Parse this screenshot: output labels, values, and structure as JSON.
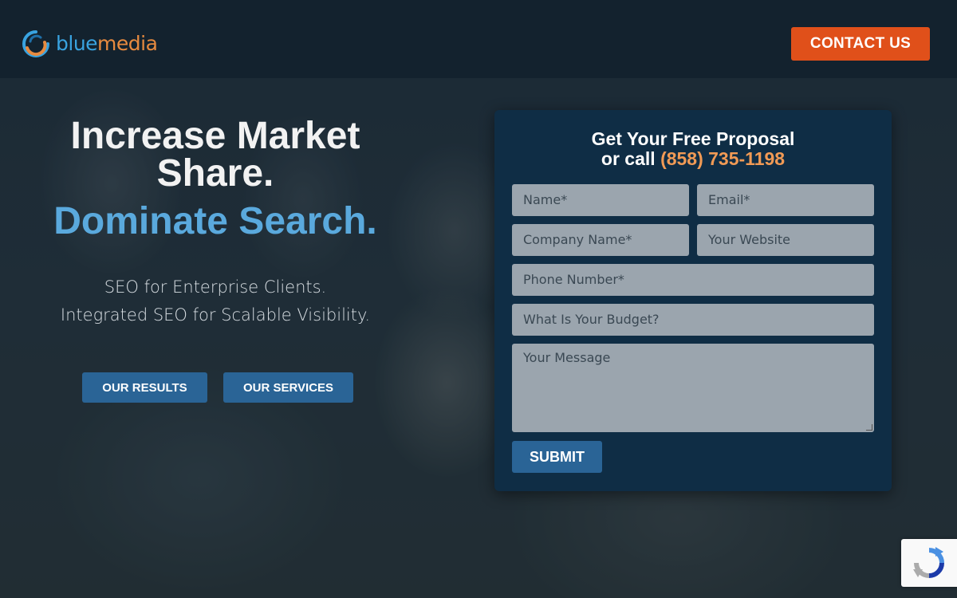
{
  "brand": {
    "name_part1": "blue",
    "name_part2": "media",
    "colors": {
      "blue": "#39a3e0",
      "orange": "#e78a3f"
    }
  },
  "header": {
    "contact_label": "CONTACT US",
    "contact_color": "#e0501a"
  },
  "hero": {
    "headline_line1": "Increase Market",
    "headline_line2": "Share.",
    "headline_accent": "Dominate Search.",
    "sub_line1": "SEO for Enterprise Clients.",
    "sub_line2": "Integrated SEO for Scalable Visibility.",
    "buttons": {
      "results": "OUR RESULTS",
      "services": "OUR SERVICES"
    }
  },
  "form": {
    "title_line1": "Get Your Free Proposal",
    "title_call": "or call ",
    "title_phone": "(858) 735-1198",
    "placeholders": {
      "name": "Name*",
      "email": "Email*",
      "company": "Company Name*",
      "website": "Your Website",
      "phone": "Phone Number*",
      "budget": "What Is Your Budget?",
      "message": "Your Message"
    },
    "submit_label": "SUBMIT"
  },
  "icons": {
    "logo": "bluemedia-swirl-logo-icon",
    "recaptcha": "recaptcha-icon"
  }
}
